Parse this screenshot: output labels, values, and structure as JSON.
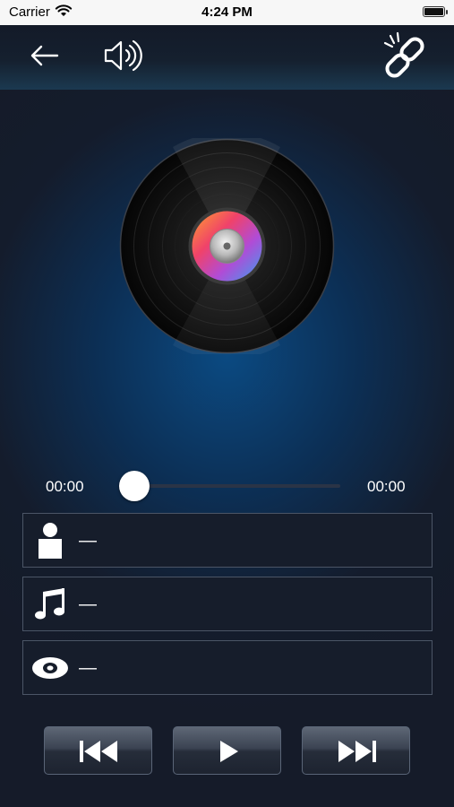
{
  "status_bar": {
    "carrier": "Carrier",
    "time": "4:24 PM",
    "icons": [
      "wifi-icon",
      "battery-icon"
    ]
  },
  "nav": {
    "icons": [
      "back-arrow-icon",
      "speaker-icon",
      "broken-link-icon"
    ]
  },
  "player": {
    "current_time": "00:00",
    "total_time": "00:00",
    "progress": 0
  },
  "track_info": {
    "artist": "—",
    "title": "—",
    "album": "—",
    "icons": [
      "person-icon",
      "music-note-icon",
      "disc-icon"
    ]
  },
  "controls": {
    "icons": [
      "previous-icon",
      "play-icon",
      "next-icon"
    ]
  },
  "colors": {
    "background": "#151b29",
    "glow": "#0b4a82",
    "row_border": "#4b5566",
    "button": "#3b4352"
  }
}
